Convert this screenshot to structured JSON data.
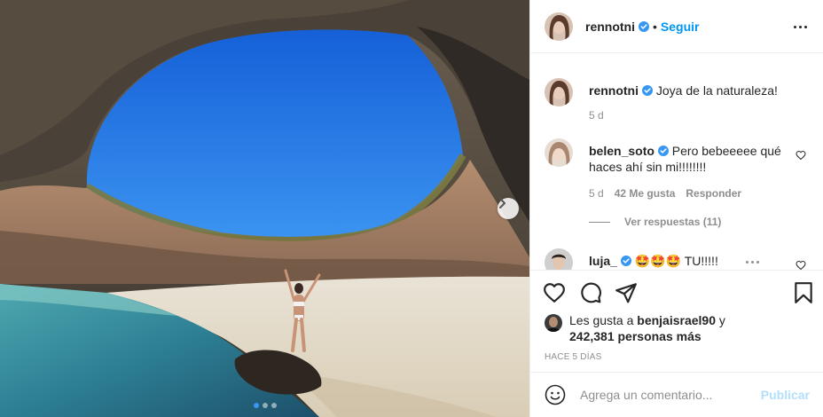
{
  "post": {
    "author": "rennotni",
    "follow_label": "Seguir",
    "separator": "•",
    "carousel": {
      "slide_count": 3,
      "active_index": 0
    }
  },
  "comments": [
    {
      "user": "rennotni",
      "text": "Joya de la naturaleza!",
      "time": "5 d",
      "verified": true
    },
    {
      "user": "belen_soto",
      "text": "Pero bebeeeee qué haces ahí sin mi!!!!!!!!",
      "time": "5 d",
      "likes": "42 Me gusta",
      "reply_label": "Responder",
      "verified": true,
      "view_replies": "Ver respuestas (11)"
    },
    {
      "user": "luja_",
      "text": "🤩🤩🤩 TU!!!!!",
      "verified": true
    }
  ],
  "likes": {
    "prefix": "Les gusta a",
    "first_user": "benjaisrael90",
    "connector": "y",
    "others": "242,381 personas más"
  },
  "timestamp": "HACE 5 DÍAS",
  "composer": {
    "placeholder": "Agrega un comentario...",
    "publish_label": "Publicar"
  },
  "icons": {
    "like": "heart-icon",
    "comment": "comment-icon",
    "share": "share-icon",
    "save": "bookmark-icon",
    "more": "more-options-icon",
    "verified": "verified-badge-icon",
    "emoji": "emoji-icon",
    "next": "chevron-right-icon"
  },
  "colors": {
    "accent": "#0095f6",
    "verified": "#3897f0",
    "publish_disabled": "#b2dffc",
    "muted": "#8e8e8e"
  }
}
